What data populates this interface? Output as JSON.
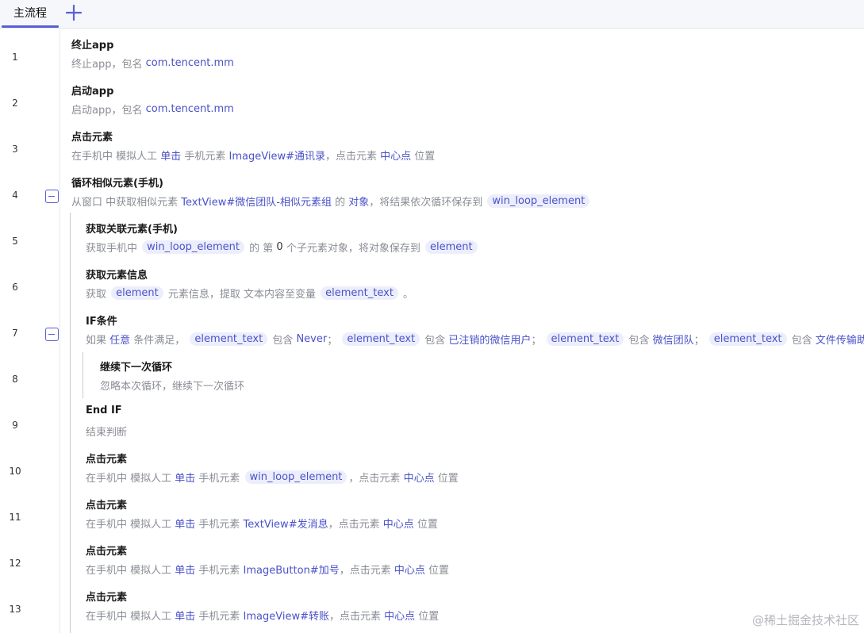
{
  "tabs": [
    {
      "label": "主流程"
    }
  ],
  "add_tab_icon": "plus-icon",
  "accent_color": "#5a5fd6",
  "steps": [
    {
      "num": "1",
      "title": "终止app",
      "desc": [
        {
          "t": "终止app，包名 "
        },
        {
          "t": "com.tencent.mm",
          "k": "link"
        }
      ]
    },
    {
      "num": "2",
      "title": "启动app",
      "desc": [
        {
          "t": "启动app，包名 "
        },
        {
          "t": "com.tencent.mm",
          "k": "link"
        }
      ]
    },
    {
      "num": "3",
      "title": "点击元素",
      "desc": [
        {
          "t": "在手机中 模拟人工 "
        },
        {
          "t": "单击",
          "k": "link"
        },
        {
          "t": " 手机元素 "
        },
        {
          "t": "ImageView#通讯录",
          "k": "link"
        },
        {
          "t": "，点击元素 "
        },
        {
          "t": "中心点",
          "k": "link"
        },
        {
          "t": " 位置"
        }
      ]
    },
    {
      "num": "4",
      "title": "循环相似元素(手机)",
      "collapse": true,
      "desc": [
        {
          "t": "从窗口 中获取相似元素 "
        },
        {
          "t": "TextView#微信团队-相似元素组",
          "k": "link"
        },
        {
          "t": " 的 "
        },
        {
          "t": "对象",
          "k": "link"
        },
        {
          "t": "，将结果依次循环保存到 "
        },
        {
          "t": "win_loop_element",
          "k": "var"
        }
      ]
    },
    {
      "num": "5",
      "title": "获取关联元素(手机)",
      "desc": [
        {
          "t": "获取手机中 "
        },
        {
          "t": "win_loop_element",
          "k": "var"
        },
        {
          "t": " 的 第 "
        },
        {
          "t": "0",
          "k": "dark"
        },
        {
          "t": " 个子元素对象，将对象保存到 "
        },
        {
          "t": "element",
          "k": "var"
        }
      ]
    },
    {
      "num": "6",
      "title": "获取元素信息",
      "desc": [
        {
          "t": "获取 "
        },
        {
          "t": "element",
          "k": "var"
        },
        {
          "t": " 元素信息，提取 文本内容至变量 "
        },
        {
          "t": "element_text",
          "k": "var"
        },
        {
          "t": " 。"
        }
      ]
    },
    {
      "num": "7",
      "title": "IF条件",
      "collapse": true,
      "desc": [
        {
          "t": "如果 "
        },
        {
          "t": "任意",
          "k": "link"
        },
        {
          "t": " 条件满足， "
        },
        {
          "t": "element_text",
          "k": "var"
        },
        {
          "t": " 包含 "
        },
        {
          "t": "Never",
          "k": "link"
        },
        {
          "t": "； "
        },
        {
          "t": "element_text",
          "k": "var"
        },
        {
          "t": " 包含 "
        },
        {
          "t": "已注销的微信用户",
          "k": "link"
        },
        {
          "t": "； "
        },
        {
          "t": "element_text",
          "k": "var"
        },
        {
          "t": " 包含 "
        },
        {
          "t": "微信团队",
          "k": "link"
        },
        {
          "t": "； "
        },
        {
          "t": "element_text",
          "k": "var"
        },
        {
          "t": " 包含 "
        },
        {
          "t": "文件传输助",
          "k": "link"
        }
      ]
    },
    {
      "num": "8",
      "title": "继续下一次循环",
      "desc": [
        {
          "t": "忽略本次循环，继续下一次循环"
        }
      ]
    },
    {
      "num": "9",
      "title": "End IF",
      "desc": [
        {
          "t": "结束判断"
        }
      ]
    },
    {
      "num": "10",
      "title": "点击元素",
      "desc": [
        {
          "t": "在手机中 模拟人工 "
        },
        {
          "t": "单击",
          "k": "link"
        },
        {
          "t": " 手机元素 "
        },
        {
          "t": "win_loop_element",
          "k": "var"
        },
        {
          "t": "，点击元素 "
        },
        {
          "t": "中心点",
          "k": "link"
        },
        {
          "t": " 位置"
        }
      ]
    },
    {
      "num": "11",
      "title": "点击元素",
      "desc": [
        {
          "t": "在手机中 模拟人工 "
        },
        {
          "t": "单击",
          "k": "link"
        },
        {
          "t": " 手机元素 "
        },
        {
          "t": "TextView#发消息",
          "k": "link"
        },
        {
          "t": "，点击元素 "
        },
        {
          "t": "中心点",
          "k": "link"
        },
        {
          "t": " 位置"
        }
      ]
    },
    {
      "num": "12",
      "title": "点击元素",
      "desc": [
        {
          "t": "在手机中 模拟人工 "
        },
        {
          "t": "单击",
          "k": "link"
        },
        {
          "t": " 手机元素 "
        },
        {
          "t": "ImageButton#加号",
          "k": "link"
        },
        {
          "t": "，点击元素 "
        },
        {
          "t": "中心点",
          "k": "link"
        },
        {
          "t": " 位置"
        }
      ]
    },
    {
      "num": "13",
      "title": "点击元素",
      "desc": [
        {
          "t": "在手机中 模拟人工 "
        },
        {
          "t": "单击",
          "k": "link"
        },
        {
          "t": " 手机元素 "
        },
        {
          "t": "ImageView#转账",
          "k": "link"
        },
        {
          "t": "，点击元素 "
        },
        {
          "t": "中心点",
          "k": "link"
        },
        {
          "t": " 位置"
        }
      ]
    }
  ],
  "collapse_icon": "collapse-minus-icon",
  "watermark": "@稀土掘金技术社区"
}
